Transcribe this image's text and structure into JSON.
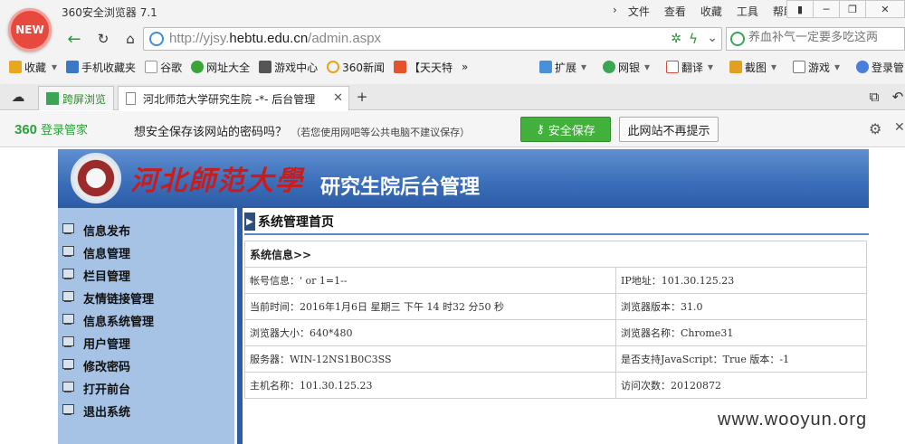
{
  "browser": {
    "new_badge": "NEW",
    "app_title": "360安全浏览器 7.1",
    "menu": [
      "文件",
      "查看",
      "收藏",
      "工具",
      "帮助"
    ],
    "url_prefix": "http://yjsy.",
    "url_domain": "hebtu.edu.cn",
    "url_path": "/admin.aspx",
    "search_placeholder": "养血补气一定要多吃这两",
    "favorites": [
      {
        "label": "收藏",
        "color": "#e8a71c"
      },
      {
        "label": "手机收藏夹",
        "color": "#3a78c8"
      },
      {
        "label": "谷歌",
        "color": "#cccccc"
      },
      {
        "label": "网址大全",
        "color": "#38a635"
      },
      {
        "label": "游戏中心",
        "color": "#555555"
      },
      {
        "label": "360新闻",
        "color": "#3a9a3a"
      },
      {
        "label": "【天天特",
        "color": "#e5532c"
      }
    ],
    "favorites_more": "»",
    "right_tools": [
      {
        "label": "扩展",
        "color": "#4a90d9"
      },
      {
        "label": "网银",
        "color": "#3aa655"
      },
      {
        "label": "翻译",
        "color": "#d94a3a"
      },
      {
        "label": "截图",
        "color": "#e0a020"
      },
      {
        "label": "游戏",
        "color": "#777777"
      },
      {
        "label": "登录管",
        "color": "#4a7ed9"
      }
    ],
    "tabs": [
      {
        "label": "跨屏浏览"
      },
      {
        "label": "河北师范大学研究生院 -*- 后台管理"
      }
    ],
    "new_tab": "+"
  },
  "password_bar": {
    "brand": "360",
    "brand_sub": "登录管家",
    "question": "想安全保存该网站的密码吗？",
    "hint": "（若您使用网吧等公共电脑不建议保存）",
    "save_label": "安全保存",
    "never_label": "此网站不再提示"
  },
  "page": {
    "school_name": "河北師范大學",
    "banner_title": "研究生院后台管理",
    "sidebar": [
      "信息发布",
      "信息管理",
      "栏目管理",
      "友情链接管理",
      "信息系统管理",
      "用户管理",
      "修改密码",
      "打开前台",
      "退出系统"
    ],
    "content_title": "系统管理首页",
    "info_header": "系统信息>>",
    "info_rows": [
      [
        "帐号信息：' or 1=1--",
        "IP地址：101.30.125.23"
      ],
      [
        "当前时间：2016年1月6日 星期三 下午 14 时32 分50 秒",
        "浏览器版本：31.0"
      ],
      [
        "浏览器大小：640*480",
        "浏览器名称：Chrome31"
      ],
      [
        "服务器：WIN-12NS1B0C3SS",
        "是否支持JavaScript：True 版本：-1"
      ],
      [
        "主机名称：101.30.125.23",
        "访问次数：20120872"
      ]
    ]
  },
  "watermark": "www.wooyun.org"
}
